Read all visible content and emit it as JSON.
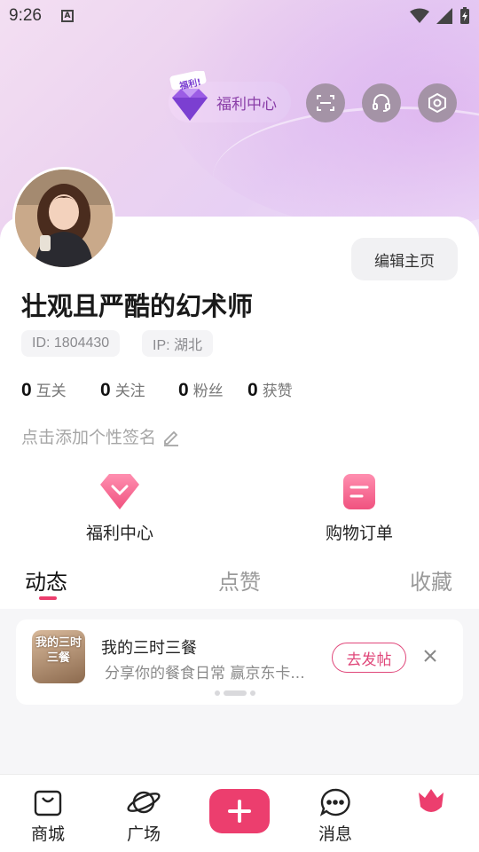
{
  "status_bar": {
    "time": "9:26",
    "notification_glyph": "A"
  },
  "header": {
    "welfare_badge": "福利!",
    "welfare_label": "福利中心",
    "icons": [
      "scan-icon",
      "headset-icon",
      "settings-hex-icon"
    ]
  },
  "profile": {
    "nickname": "壮观且严酷的幻术师",
    "id_label": "ID: 1804430",
    "ip_label": "IP: 湖北",
    "edit_button": "编辑主页",
    "signature_placeholder": "点击添加个性签名"
  },
  "stats": [
    {
      "value": "0",
      "label": "互关"
    },
    {
      "value": "0",
      "label": "关注"
    },
    {
      "value": "0",
      "label": "粉丝"
    },
    {
      "value": "0",
      "label": "获赞"
    }
  ],
  "quick_actions": [
    {
      "label": "福利中心",
      "icon": "diamond-icon"
    },
    {
      "label": "购物订单",
      "icon": "order-icon"
    }
  ],
  "tabs": [
    {
      "label": "动态",
      "active": true
    },
    {
      "label": "点赞",
      "active": false
    },
    {
      "label": "收藏",
      "active": false
    }
  ],
  "promo": {
    "thumb_text": "我的三时三餐",
    "title": "我的三时三餐",
    "description": "分享你的餐食日常 赢京东卡...",
    "button": "去发帖"
  },
  "bottom_nav": [
    {
      "label": "商城",
      "icon": "shopping-bag-icon"
    },
    {
      "label": "广场",
      "icon": "planet-icon"
    },
    {
      "label": "",
      "icon": "plus-icon"
    },
    {
      "label": "消息",
      "icon": "message-icon"
    },
    {
      "label": "",
      "icon": "tulip-icon"
    }
  ],
  "colors": {
    "accent": "#ec3e6e",
    "welfare_text": "#8a3ea8"
  }
}
